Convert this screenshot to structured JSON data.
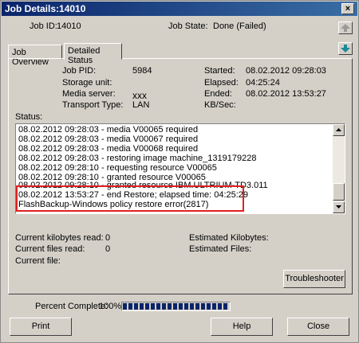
{
  "window": {
    "title": "Job Details:14010",
    "close_glyph": "×"
  },
  "header": {
    "job_id_label": "Job ID:",
    "job_id_value": "14010",
    "job_state_label": "Job State:",
    "job_state_value": "Done (Failed)"
  },
  "tabs": [
    {
      "label": "Job Overview",
      "active": false
    },
    {
      "label": "Detailed Status",
      "active": true
    }
  ],
  "details": {
    "job_pid_label": "Job PID:",
    "job_pid_value": "5984",
    "storage_unit_label": "Storage unit:",
    "storage_unit_value": "",
    "media_server_label": "Media server:",
    "media_server_value": "xxx",
    "transport_type_label": "Transport Type:",
    "transport_type_value": "LAN",
    "started_label": "Started:",
    "started_value": "08.02.2012 09:28:03",
    "elapsed_label": "Elapsed:",
    "elapsed_value": "04:25:24",
    "ended_label": "Ended:",
    "ended_value": "08.02.2012 13:53:27",
    "kbsec_label": "KB/Sec:",
    "kbsec_value": ""
  },
  "status": {
    "label": "Status:",
    "lines": [
      "08.02.2012 09:28:03 - media V00065 required",
      "08.02.2012 09:28:03 - media V00067 required",
      "08.02.2012 09:28:03 - media V00068 required",
      "08.02.2012 09:28:03 - restoring image machine_1319179228",
      "08.02.2012 09:28:10 - requesting resource V00065",
      "08.02.2012 09:28:10 - granted resource V00065",
      "08.02.2012 09:28:10 - granted resource IBM.ULTRIUM-TD3.011",
      "08.02.2012 13:53:27 - end Restore; elapsed time: 04:25:29",
      "FlashBackup-Windows policy restore error(2817)"
    ]
  },
  "stats": {
    "current_kb_read_label": "Current kilobytes read:",
    "current_kb_read_value": "0",
    "current_files_read_label": "Current files read:",
    "current_files_read_value": "0",
    "current_file_label": "Current file:",
    "current_file_value": "",
    "estimated_kb_label": "Estimated Kilobytes:",
    "estimated_kb_value": "",
    "estimated_files_label": "Estimated Files:",
    "estimated_files_value": ""
  },
  "buttons": {
    "troubleshooter": "Troubleshooter",
    "print": "Print",
    "help": "Help",
    "close": "Close"
  },
  "progress": {
    "label": "Percent Complete:",
    "value_text": "100%",
    "fraction": 1.0
  },
  "colors": {
    "title_bar": "#0a246a",
    "progress_fill": "#0a246a",
    "highlight_box": "#e02020"
  },
  "icons": {
    "up_arrow": "up-arrow-icon",
    "down_arrow": "down-arrow-icon"
  }
}
